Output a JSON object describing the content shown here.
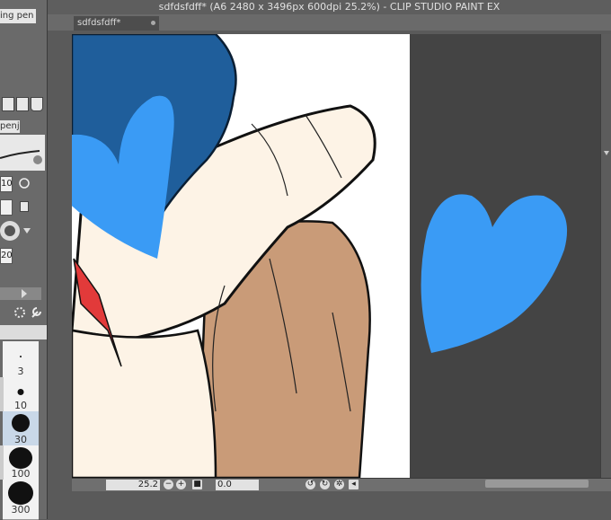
{
  "window": {
    "title": "sdfdsfdff* (A6 2480 x 3496px 600dpi 25.2%)  - CLIP STUDIO PAINT EX"
  },
  "document_tab": {
    "label": "sdfdsfdff*"
  },
  "left_panel": {
    "tool_tab_label": "ing pen",
    "sub_tool_tab_label": "penj",
    "brush_size_field": "10",
    "stabilization_field": "20",
    "brush_sizes": [
      "3",
      "10",
      "30",
      "100",
      "300"
    ]
  },
  "status_bar": {
    "zoom": "25.2",
    "rotation": "0.0"
  },
  "colors": {
    "paper": "#ffffff",
    "canvas_bg": "#444444",
    "heart": "#3a9bf5",
    "hair": "#1f5e9b",
    "skin": "#fdf3e6",
    "shirt": "#c99b78",
    "accent_red": "#e23a3a"
  }
}
